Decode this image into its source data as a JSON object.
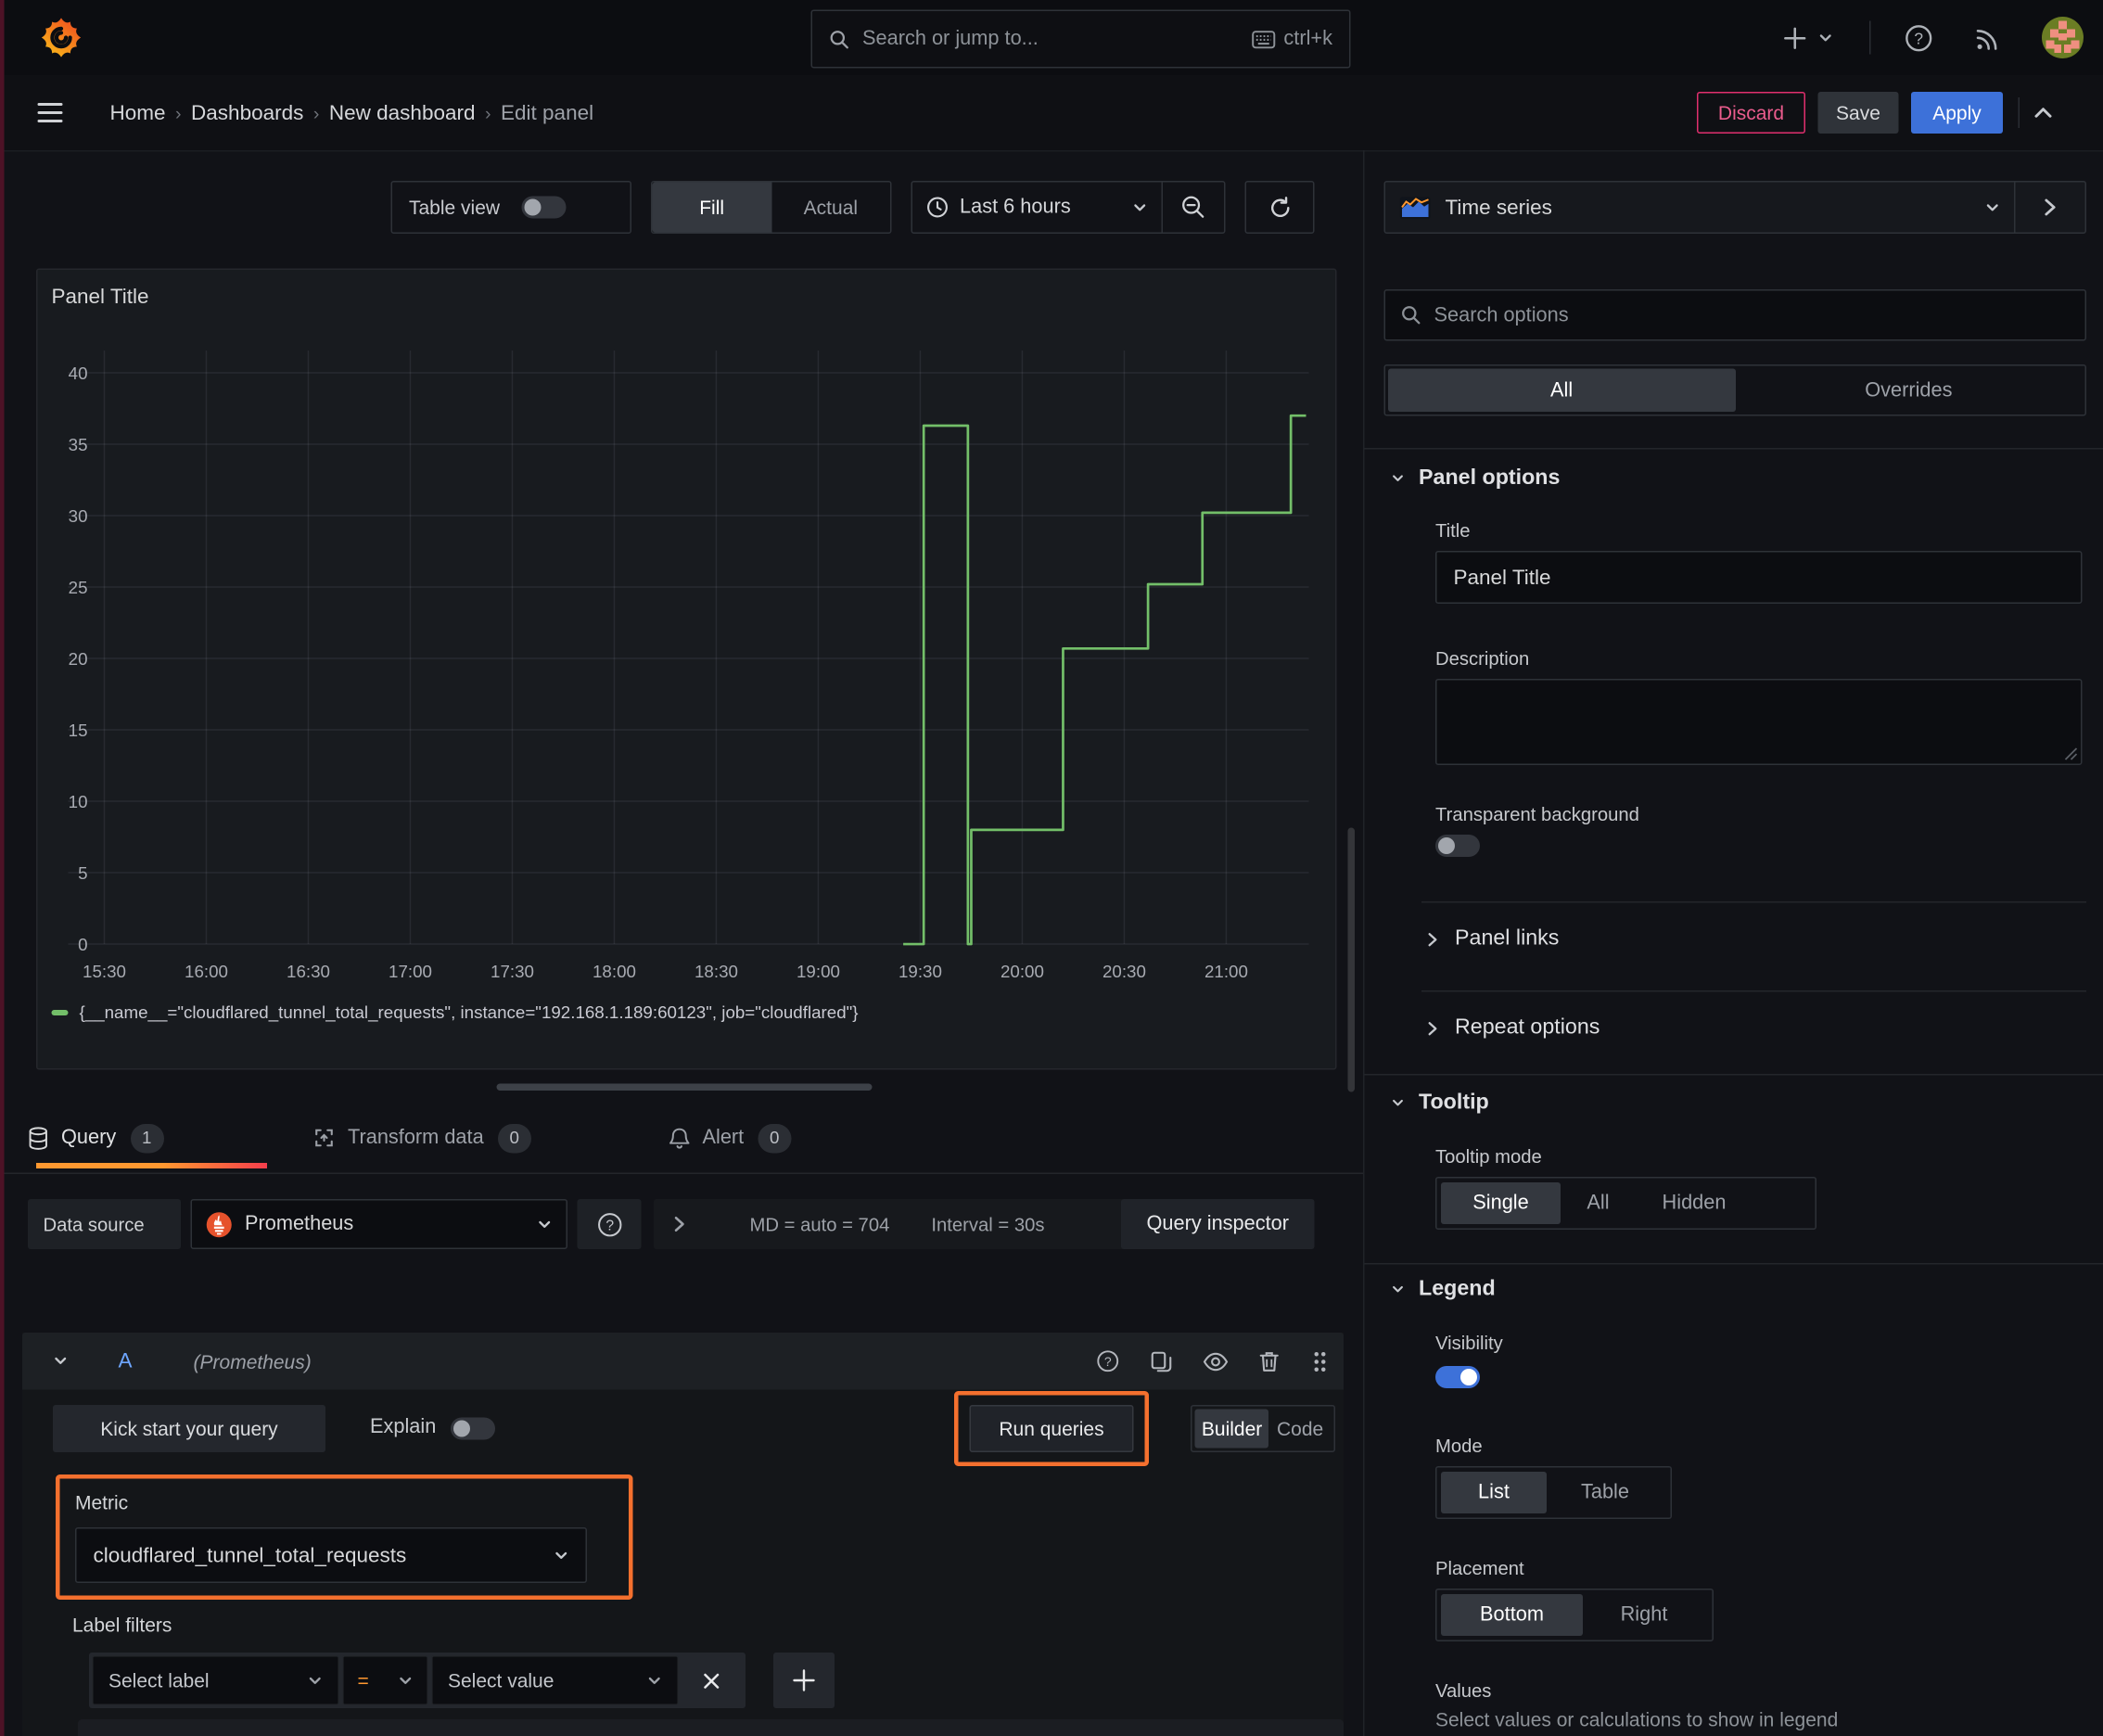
{
  "topnav": {
    "search_placeholder": "Search or jump to...",
    "shortcut": "ctrl+k"
  },
  "breadcrumb": {
    "items": [
      "Home",
      "Dashboards",
      "New dashboard",
      "Edit panel"
    ]
  },
  "actions": {
    "discard": "Discard",
    "save": "Save",
    "apply": "Apply"
  },
  "toolbar": {
    "table_view": "Table view",
    "fill": "Fill",
    "actual": "Actual",
    "time_range": "Last 6 hours"
  },
  "panel": {
    "title": "Panel Title"
  },
  "chart_data": {
    "type": "line",
    "step": "after",
    "title": "Panel Title",
    "x_ticks": [
      "15:30",
      "16:00",
      "16:30",
      "17:00",
      "17:30",
      "18:00",
      "18:30",
      "19:00",
      "19:30",
      "20:00",
      "20:30",
      "21:00"
    ],
    "y_ticks": [
      0,
      5,
      10,
      15,
      20,
      25,
      30,
      35,
      40
    ],
    "ylim": [
      0,
      40
    ],
    "xlim": [
      "15:27",
      "21:21"
    ],
    "grid": true,
    "legend_position": "bottom",
    "series": [
      {
        "name": "{__name__=\"cloudflared_tunnel_total_requests\", instance=\"192.168.1.189:60123\", job=\"cloudflared\"}",
        "color": "#73bf69",
        "points": [
          [
            "19:25",
            0
          ],
          [
            "19:31",
            36.3
          ],
          [
            "19:44",
            0
          ],
          [
            "19:45",
            8
          ],
          [
            "20:12",
            20.7
          ],
          [
            "20:37",
            25.2
          ],
          [
            "20:53",
            30.2
          ],
          [
            "21:19",
            37
          ]
        ]
      }
    ]
  },
  "query": {
    "tabs": [
      {
        "label": "Query",
        "count": "1"
      },
      {
        "label": "Transform data",
        "count": "0"
      },
      {
        "label": "Alert",
        "count": "0"
      }
    ],
    "datasource_label": "Data source",
    "datasource": "Prometheus",
    "md_stat": "MD = auto = 704",
    "interval_stat": "Interval = 30s",
    "inspector": "Query inspector",
    "ref_id": "A",
    "ref_hint": "(Prometheus)",
    "kickstart": "Kick start your query",
    "explain": "Explain",
    "run": "Run queries",
    "builder": "Builder",
    "code": "Code",
    "metric_label": "Metric",
    "metric_value": "cloudflared_tunnel_total_requests",
    "filters_label": "Label filters",
    "select_label": "Select label",
    "operator": "=",
    "select_value": "Select value"
  },
  "sidebar": {
    "viz": "Time series",
    "search_placeholder": "Search options",
    "tabs": {
      "all": "All",
      "overrides": "Overrides"
    },
    "panel_options": {
      "title": "Panel options",
      "title_label": "Title",
      "title_value": "Panel Title",
      "description_label": "Description",
      "transparent_label": "Transparent background"
    },
    "links": {
      "panel_links": "Panel links",
      "repeat_options": "Repeat options"
    },
    "tooltip": {
      "title": "Tooltip",
      "mode_label": "Tooltip mode",
      "options": [
        "Single",
        "All",
        "Hidden"
      ]
    },
    "legend": {
      "title": "Legend",
      "visibility_label": "Visibility",
      "mode_label": "Mode",
      "mode_options": [
        "List",
        "Table"
      ],
      "placement_label": "Placement",
      "placement_options": [
        "Bottom",
        "Right"
      ],
      "values_label": "Values",
      "values_hint": "Select values or calculations to show in legend"
    }
  },
  "colors": {
    "accent": "#3d71d9",
    "series_green": "#73bf69",
    "tab_gradient_start": "#ff9830",
    "tab_gradient_end": "#f53e4c",
    "highlight_orange": "#f4702e",
    "destructive": "#e02f6e"
  }
}
